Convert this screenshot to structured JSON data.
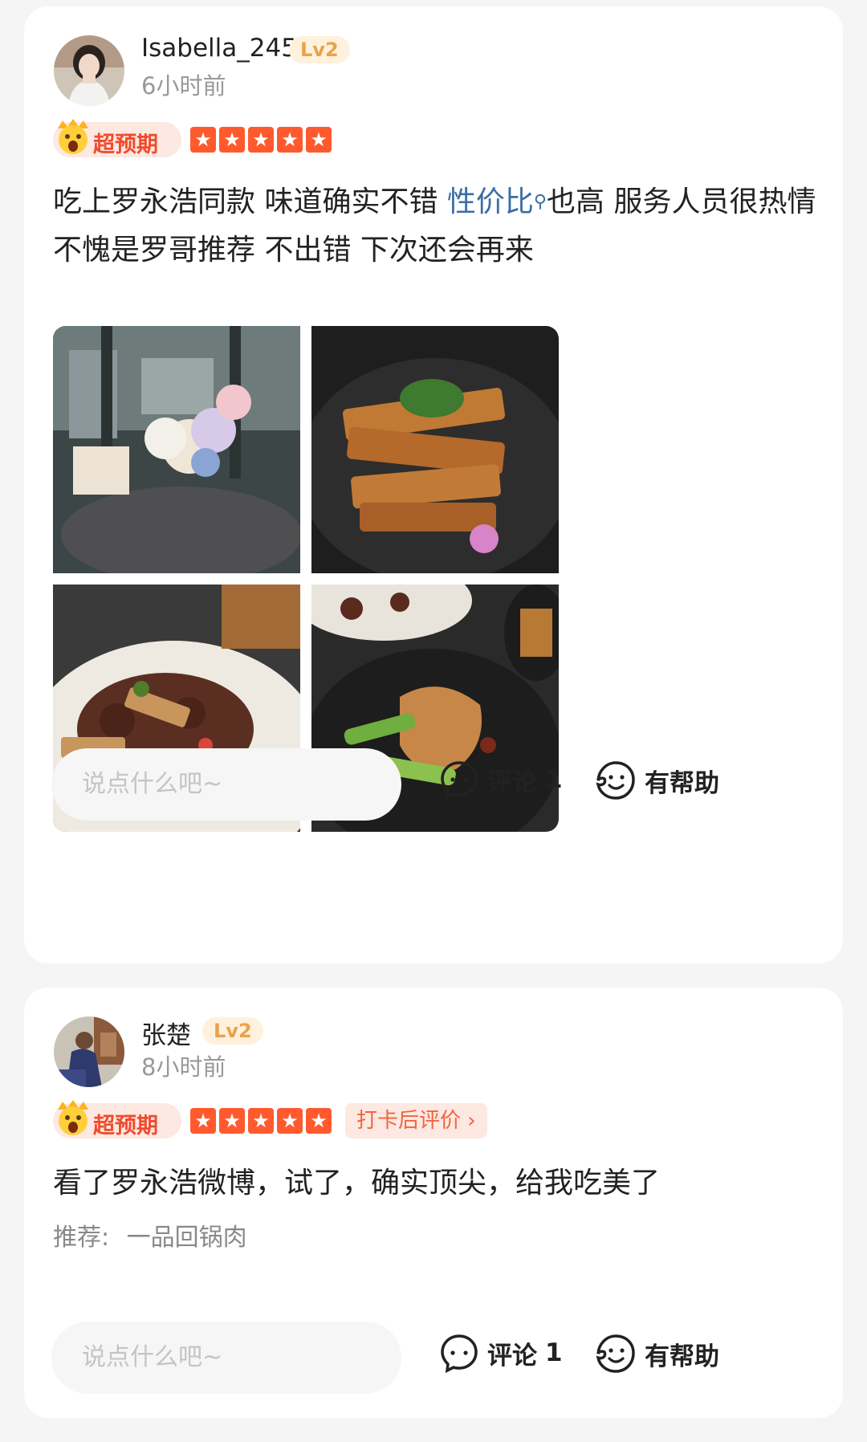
{
  "reviews": [
    {
      "username": "Isabella_2454",
      "level": "Lv2",
      "time": "6小时前",
      "exceed_label": "超预期",
      "stars": 5,
      "text_before_link": "吃上罗永浩同款 味道确实不错 ",
      "link_text": "性价比",
      "text_after_link": "也高 服务人员很热情 不愧是罗哥推荐 不出错 下次还会再来",
      "photos": [
        "dining-table-flowers",
        "stacked-tofu-dish",
        "beef-stir-fry",
        "twice-cooked-pork"
      ],
      "comment_placeholder": "说点什么吧~",
      "comment_label": "评论",
      "comment_count": "1",
      "helpful_label": "有帮助"
    },
    {
      "username": "张楚",
      "level": "Lv2",
      "time": "8小时前",
      "exceed_label": "超预期",
      "stars": 5,
      "checkin_label": "打卡后评价 ›",
      "text": "看了罗永浩微博，试了，确实顶尖，给我吃美了",
      "recommend_label": "推荐:",
      "recommend_dish": "一品回锅肉",
      "comment_placeholder": "说点什么吧~",
      "comment_label": "评论",
      "comment_count": "1",
      "helpful_label": "有帮助"
    }
  ],
  "colors": {
    "accent": "#f04b2c",
    "star": "#ff5a2e",
    "link": "#3b6da3",
    "level": "#e9a24b"
  }
}
